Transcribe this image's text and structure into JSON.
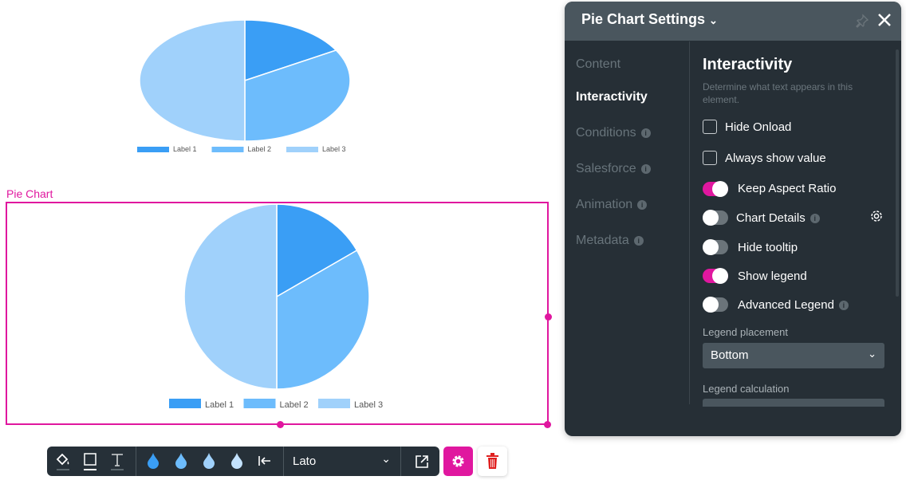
{
  "canvas": {
    "selected_element_label": "Pie Chart"
  },
  "chart_data": [
    {
      "type": "pie",
      "note_shape": "stretched",
      "categories": [
        "Label 1",
        "Label 2",
        "Label 3"
      ],
      "values": [
        1,
        2,
        3
      ],
      "colors": [
        "#3a9ef5",
        "#6dbcfc",
        "#a0d1fb"
      ],
      "legend": "bottom"
    },
    {
      "type": "pie",
      "categories": [
        "Label 1",
        "Label 2",
        "Label 3"
      ],
      "values": [
        1,
        2,
        3
      ],
      "colors": [
        "#3a9ef5",
        "#6dbcfc",
        "#a0d1fb"
      ],
      "legend": "bottom"
    }
  ],
  "panel": {
    "title": "Pie Chart Settings",
    "nav": [
      {
        "label": "Content"
      },
      {
        "label": "Interactivity"
      },
      {
        "label": "Conditions"
      },
      {
        "label": "Salesforce"
      },
      {
        "label": "Animation"
      },
      {
        "label": "Metadata"
      }
    ],
    "section_title": "Interactivity",
    "section_desc": "Determine what text appears in this element.",
    "checkboxes": [
      {
        "label": "Hide Onload",
        "checked": false
      },
      {
        "label": "Always show value",
        "checked": false
      }
    ],
    "toggles": [
      {
        "label": "Keep Aspect Ratio",
        "on": true
      },
      {
        "label": "Chart Details",
        "on": false
      },
      {
        "label": "Hide tooltip",
        "on": false
      },
      {
        "label": "Show legend",
        "on": true
      },
      {
        "label": "Advanced Legend",
        "on": false
      }
    ],
    "legend_placement_label": "Legend placement",
    "legend_placement_value": "Bottom",
    "legend_calc_label": "Legend calculation"
  },
  "toolbar": {
    "font": "Lato",
    "accent": "#e0179f"
  }
}
